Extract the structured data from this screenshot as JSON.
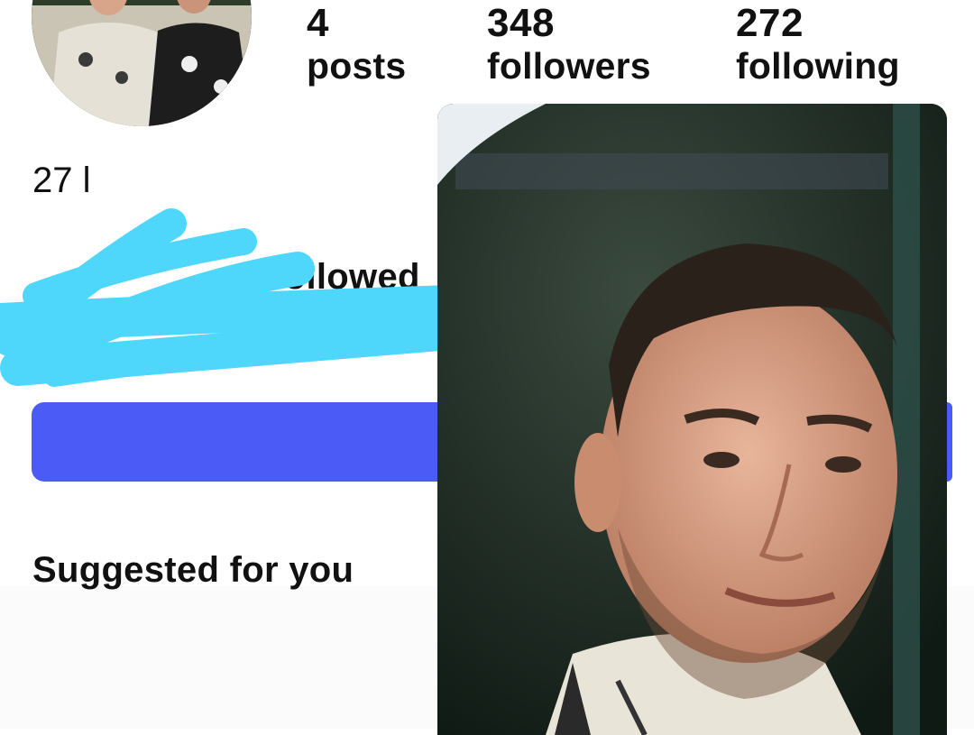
{
  "profile": {
    "stats": [
      {
        "value": "4",
        "label": "posts"
      },
      {
        "value": "348",
        "label": "followers"
      },
      {
        "value": "272",
        "label": "following"
      }
    ],
    "bio_line": "27 l",
    "followed_by_text": "Followed",
    "suggested_heading": "Suggested for you"
  },
  "colors": {
    "primary_button": "#4a5cf5",
    "scribble": "#4fd6fb"
  }
}
